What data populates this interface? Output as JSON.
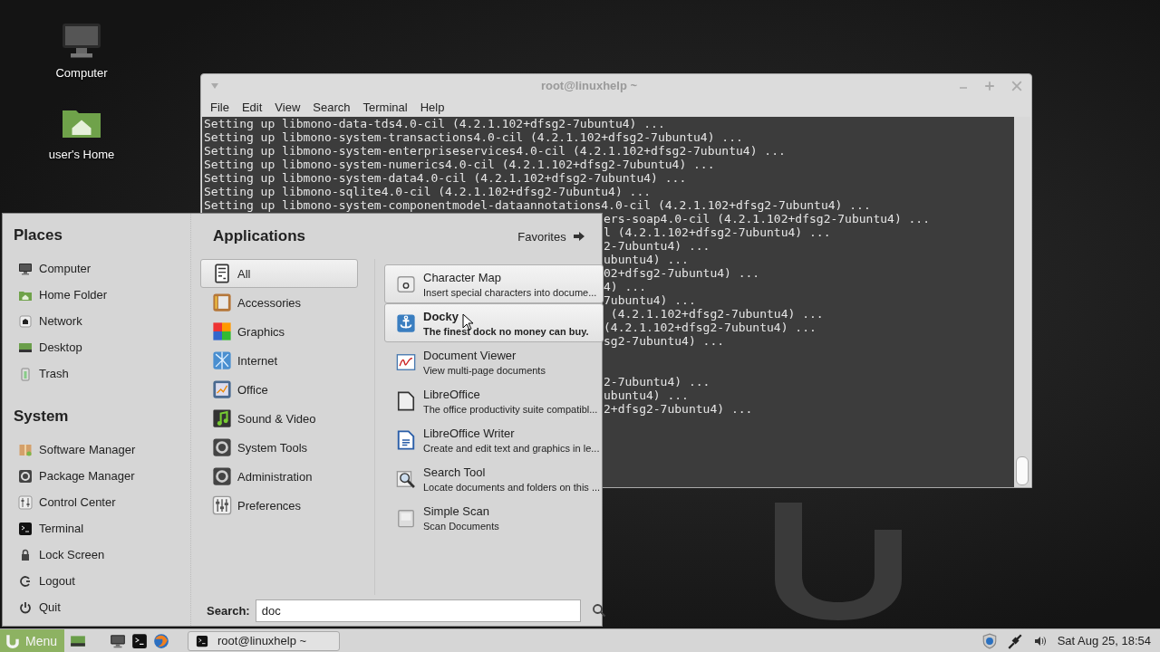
{
  "desktop_icons": [
    {
      "label": "Computer",
      "kind": "computer"
    },
    {
      "label": "user's Home",
      "kind": "home"
    }
  ],
  "terminal": {
    "title": "root@linuxhelp ~",
    "menu": [
      "File",
      "Edit",
      "View",
      "Search",
      "Terminal",
      "Help"
    ],
    "lines": [
      "Setting up libmono-data-tds4.0-cil (4.2.1.102+dfsg2-7ubuntu4) ...",
      "Setting up libmono-system-transactions4.0-cil (4.2.1.102+dfsg2-7ubuntu4) ...",
      "Setting up libmono-system-enterpriseservices4.0-cil (4.2.1.102+dfsg2-7ubuntu4) ...",
      "Setting up libmono-system-numerics4.0-cil (4.2.1.102+dfsg2-7ubuntu4) ...",
      "Setting up libmono-system-data4.0-cil (4.2.1.102+dfsg2-7ubuntu4) ...",
      "Setting up libmono-sqlite4.0-cil (4.2.1.102+dfsg2-7ubuntu4) ...",
      "Setting up libmono-system-componentmodel-dataannotations4.0-cil (4.2.1.102+dfsg2-7ubuntu4) ..."
    ],
    "partly_hidden_blocks": [
      [
        "ers-soap4.0-cil (4.2.1.102+dfsg2-7ubuntu4) ...",
        "l (4.2.1.102+dfsg2-7ubuntu4) ...",
        "2-7ubuntu4) ...",
        "ubuntu4) ...",
        "02+dfsg2-7ubuntu4) ...",
        "4) ...",
        "7ubuntu4) ...",
        " (4.2.1.102+dfsg2-7ubuntu4) ...",
        "(4.2.1.102+dfsg2-7ubuntu4) ...",
        "sg2-7ubuntu4) ..."
      ],
      [
        "2-7ubuntu4) ...",
        "ubuntu4) ...",
        "2+dfsg2-7ubuntu4) ..."
      ]
    ]
  },
  "menu": {
    "places": {
      "title": "Places",
      "items": [
        {
          "label": "Computer",
          "kind": "computer"
        },
        {
          "label": "Home Folder",
          "kind": "home"
        },
        {
          "label": "Network",
          "kind": "network"
        },
        {
          "label": "Desktop",
          "kind": "desktop"
        },
        {
          "label": "Trash",
          "kind": "trash"
        }
      ]
    },
    "system": {
      "title": "System",
      "items": [
        {
          "label": "Software Manager",
          "kind": "software"
        },
        {
          "label": "Package Manager",
          "kind": "package"
        },
        {
          "label": "Control Center",
          "kind": "control"
        },
        {
          "label": "Terminal",
          "kind": "terminal"
        },
        {
          "label": "Lock Screen",
          "kind": "lock"
        },
        {
          "label": "Logout",
          "kind": "logout"
        },
        {
          "label": "Quit",
          "kind": "quit"
        }
      ]
    },
    "applications": {
      "title": "Applications",
      "favorites": "Favorites",
      "categories": [
        {
          "label": "All",
          "kind": "all",
          "selected": true
        },
        {
          "label": "Accessories",
          "kind": "accessories",
          "selected": false
        },
        {
          "label": "Graphics",
          "kind": "graphics",
          "selected": false
        },
        {
          "label": "Internet",
          "kind": "internet",
          "selected": false
        },
        {
          "label": "Office",
          "kind": "office",
          "selected": false
        },
        {
          "label": "Sound & Video",
          "kind": "sound",
          "selected": false
        },
        {
          "label": "System Tools",
          "kind": "systools",
          "selected": false
        },
        {
          "label": "Administration",
          "kind": "admin",
          "selected": false
        },
        {
          "label": "Preferences",
          "kind": "prefs",
          "selected": false
        }
      ],
      "apps": [
        {
          "name": "Character Map",
          "description": "Insert special characters into docume...",
          "kind": "charmap",
          "highlighted": true,
          "hovered": false
        },
        {
          "name": "Docky",
          "description": "The finest dock no money can buy.",
          "kind": "docky",
          "highlighted": true,
          "hovered": true
        },
        {
          "name": "Document Viewer",
          "description": "View multi-page documents",
          "kind": "docviewer",
          "highlighted": false,
          "hovered": false
        },
        {
          "name": "LibreOffice",
          "description": "The office productivity suite compatibl...",
          "kind": "libreoffice",
          "highlighted": false,
          "hovered": false
        },
        {
          "name": "LibreOffice Writer",
          "description": "Create and edit text and graphics in le...",
          "kind": "writer",
          "highlighted": false,
          "hovered": false
        },
        {
          "name": "Search Tool",
          "description": "Locate documents and folders on this ...",
          "kind": "searchtool",
          "highlighted": false,
          "hovered": false
        },
        {
          "name": "Simple Scan",
          "description": "Scan Documents",
          "kind": "scan",
          "highlighted": false,
          "hovered": false
        }
      ]
    },
    "search": {
      "label": "Search:",
      "value": "doc"
    }
  },
  "taskbar": {
    "menu_button": "Menu",
    "launchers": [
      {
        "kind": "showdesktop"
      },
      {
        "kind": "computer"
      },
      {
        "kind": "terminal"
      },
      {
        "kind": "browser"
      }
    ],
    "windows": [
      {
        "label": "root@linuxhelp ~",
        "selected": false
      }
    ],
    "clock": "Sat Aug 25, 18:54"
  }
}
